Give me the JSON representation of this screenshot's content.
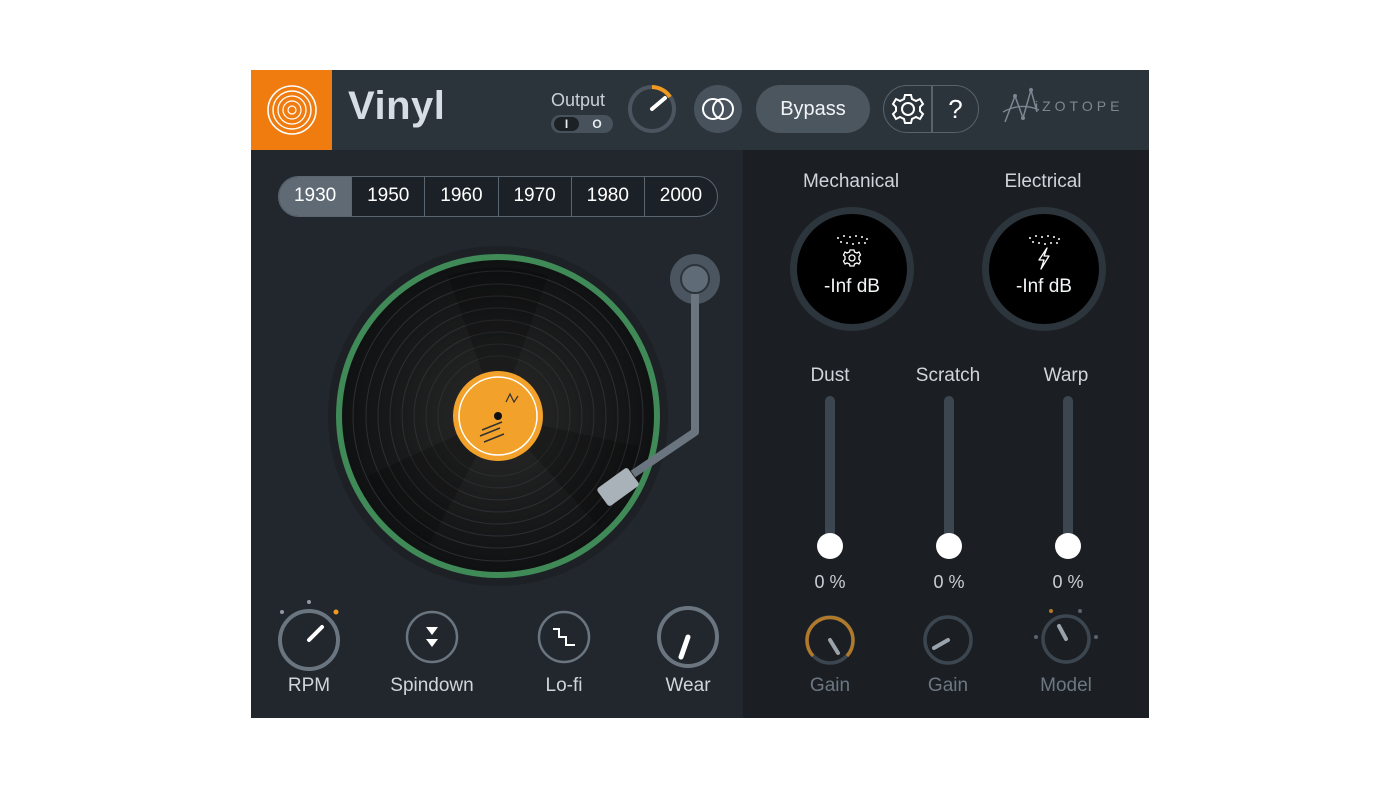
{
  "header": {
    "title": "Vinyl",
    "output_label": "Output",
    "output_toggle": {
      "on_label": "I",
      "off_label": "O",
      "selected": "I"
    },
    "bypass_label": "Bypass",
    "help_label": "?",
    "brand": "iZOTOPE"
  },
  "eras": {
    "items": [
      "1930",
      "1950",
      "1960",
      "1970",
      "1980",
      "2000"
    ],
    "selected": "1930"
  },
  "turntable": {
    "rpm_label": "RPM",
    "spindown_label": "Spindown",
    "lofi_label": "Lo-fi",
    "wear_label": "Wear"
  },
  "noise": {
    "mechanical": {
      "label": "Mechanical",
      "level": "-Inf dB",
      "gain_label": "Gain"
    },
    "electrical": {
      "label": "Electrical",
      "level": "-Inf dB",
      "gain_label": "Gain",
      "model_label": "Model"
    }
  },
  "sliders": [
    {
      "label": "Dust",
      "value": "0 %"
    },
    {
      "label": "Scratch",
      "value": "0 %"
    },
    {
      "label": "Warp",
      "value": "0 %"
    }
  ],
  "colors": {
    "accent": "#f07c10",
    "label_gold": "#f2a12a",
    "platter_ring": "#3f8a57",
    "background": "#1b1f24",
    "header": "#2b333b"
  }
}
